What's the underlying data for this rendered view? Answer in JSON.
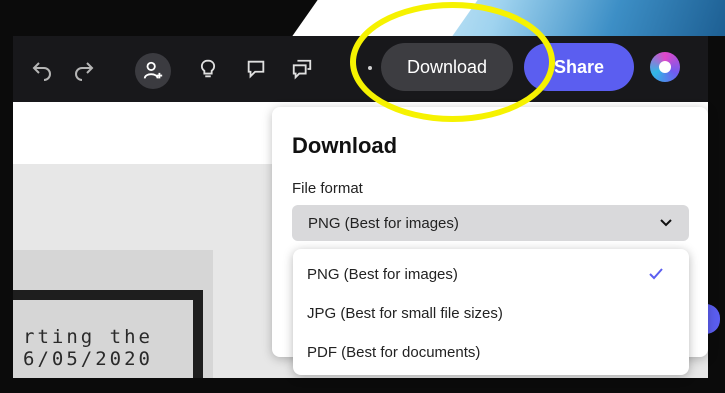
{
  "toolbar": {
    "undo_icon": "undo-icon",
    "redo_icon": "redo-icon",
    "collaborate_icon": "add-person-icon",
    "ideas_icon": "lightbulb-icon",
    "comment_icon": "comment-icon",
    "comments_icon": "comments-icon",
    "download_label": "Download",
    "share_label": "Share"
  },
  "poster": {
    "line1": "rting the",
    "line2": "6/05/2020"
  },
  "download_panel": {
    "title": "Download",
    "file_format_label": "File format",
    "selected_value": "PNG (Best for images)",
    "options": [
      {
        "label": "PNG (Best for images)",
        "selected": true
      },
      {
        "label": "JPG (Best for small file sizes)",
        "selected": false
      },
      {
        "label": "PDF (Best for documents)",
        "selected": false
      }
    ]
  },
  "colors": {
    "share_button": "#5b5ef0",
    "toolbar_bg": "#18181b",
    "highlight_ring": "#f6f200"
  }
}
